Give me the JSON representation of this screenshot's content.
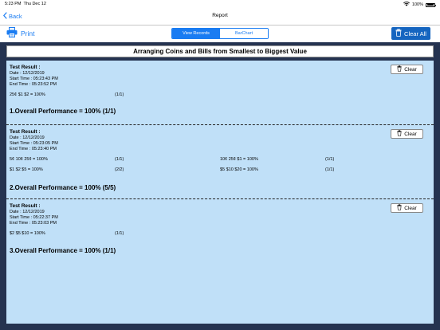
{
  "status": {
    "time": "5:23 PM",
    "date": "Thu Dec 12",
    "battery": "100%"
  },
  "nav": {
    "back_label": "Back",
    "title": "Report"
  },
  "toolbar": {
    "print_label": "Print",
    "tabs": [
      "View Records",
      "BarChart"
    ],
    "clear_all_label": "Clear All"
  },
  "report": {
    "title": "Arranging Coins and Bills from Smallest to Biggest Value",
    "result_label": "Test Result :",
    "clear_label": "Clear",
    "results": [
      {
        "date": "Date : 12/12/2019",
        "start": "Start Time : 05:23:43 PM",
        "end": "End Time   : 05:23:52 PM",
        "rows": [
          {
            "item": "25¢ $1 $2 = 100%",
            "score": "(1/1)"
          }
        ],
        "overall": "1.Overall Performance = 100% (1/1)"
      },
      {
        "date": "Date : 12/12/2019",
        "start": "Start Time : 05:23:05 PM",
        "end": "End Time   : 05:23:40 PM",
        "rows": [
          {
            "item": "5¢ 10¢ 25¢ = 100%",
            "score": "(1/1)"
          },
          {
            "item": "10¢ 25¢ $1 = 100%",
            "score": "(1/1)"
          },
          {
            "item": "$1 $2 $5 = 100%",
            "score": "(2/2)"
          },
          {
            "item": "$5 $10 $20 = 100%",
            "score": "(1/1)"
          }
        ],
        "overall": "2.Overall Performance = 100% (5/5)"
      },
      {
        "date": "Date : 12/12/2019",
        "start": "Start Time : 05:22:37 PM",
        "end": "End Time   : 05:23:03 PM",
        "rows": [
          {
            "item": "$2 $5 $10 = 100%",
            "score": "(1/1)"
          }
        ],
        "overall": "3.Overall Performance = 100% (1/1)"
      }
    ]
  },
  "colors": {
    "accent": "#1a7cf2",
    "results_bg": "#c0e0f8",
    "report_bg": "#253350"
  }
}
